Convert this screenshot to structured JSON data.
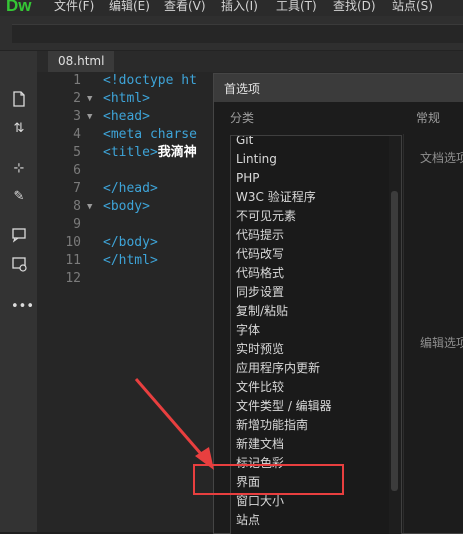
{
  "app": {
    "logo": "Dw"
  },
  "menu": [
    {
      "label": "文件(F)"
    },
    {
      "label": "编辑(E)"
    },
    {
      "label": "查看(V)"
    },
    {
      "label": "插入(I)"
    },
    {
      "label": "工具(T)"
    },
    {
      "label": "查找(D)"
    },
    {
      "label": "站点(S)"
    }
  ],
  "left_toolbar_icons": [
    "new-file-icon",
    "sort-icon",
    "split-icon",
    "edit-icon",
    "comment-icon",
    "properties-icon",
    "more-icon"
  ],
  "tab": {
    "label": "08.html"
  },
  "code_lines": [
    {
      "num": "1",
      "fold": "",
      "text": "<!doctype ht"
    },
    {
      "num": "2",
      "fold": "▼",
      "text": "<html>"
    },
    {
      "num": "3",
      "fold": "▼",
      "text": "<head>"
    },
    {
      "num": "4",
      "fold": "",
      "text": "<meta charse"
    },
    {
      "num": "5",
      "fold": "",
      "text": "<title>",
      "bold_text": "我滴神"
    },
    {
      "num": "6",
      "fold": "",
      "text": ""
    },
    {
      "num": "7",
      "fold": "",
      "text": "</head>"
    },
    {
      "num": "8",
      "fold": "▼",
      "text": "<body>"
    },
    {
      "num": "9",
      "fold": "",
      "text": ""
    },
    {
      "num": "10",
      "fold": "",
      "text": "</body>"
    },
    {
      "num": "11",
      "fold": "",
      "text": "</html>"
    },
    {
      "num": "12",
      "fold": "",
      "text": ""
    }
  ],
  "dialog": {
    "title": "首选项",
    "category_heading": "分类",
    "general_heading": "常规",
    "doc_options_label": "文档选项",
    "edit_options_label": "编辑选项",
    "categories": [
      "Git",
      "Linting",
      "PHP",
      "W3C 验证程序",
      "不可见元素",
      "代码提示",
      "代码改写",
      "代码格式",
      "同步设置",
      "复制/粘贴",
      "字体",
      "实时预览",
      "应用程序内更新",
      "文件比较",
      "文件类型 / 编辑器",
      "新增功能指南",
      "新建文档",
      "标记色彩",
      "界面",
      "窗口大小",
      "站点"
    ],
    "highlighted_category": "界面"
  },
  "colors": {
    "logo": "#35c635",
    "tag": "#3ea4d8",
    "highlight": "#e83f3f"
  }
}
